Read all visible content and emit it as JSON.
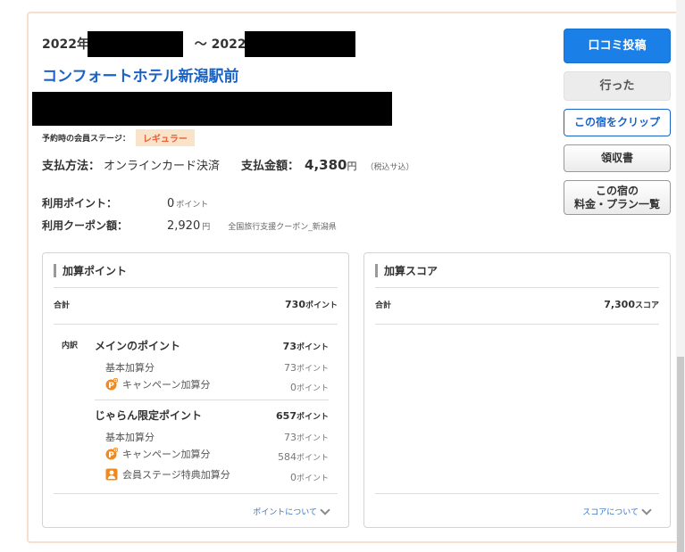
{
  "reservation": {
    "date_start": "2022年",
    "date_sep": "～ 2022年",
    "hotel_name": "コンフォートホテル新潟駅前",
    "member_stage_label": "予約時の会員ステージ：",
    "member_stage": "レギュラー",
    "payment_method_label": "支払方法：",
    "payment_method": "オンラインカード決済",
    "payment_amount_label": "支払金額：",
    "payment_amount": "4,380",
    "payment_unit": "円",
    "tax_note": "（税込サ込）",
    "points_used_label": "利用ポイント：",
    "points_used": "0",
    "points_used_unit": "ポイント",
    "coupon_label": "利用クーポン額：",
    "coupon_amount": "2,920",
    "coupon_unit": "円",
    "coupon_name": "全国旅行支援クーポン_新潟県"
  },
  "actions": {
    "review": "口コミ投稿",
    "visited": "行った",
    "clip": "この宿をクリップ",
    "receipt": "領収書",
    "plan_line1": "この宿の",
    "plan_line2": "料金・プラン一覧"
  },
  "points_panel": {
    "title": "加算ポイント",
    "total_label": "合計",
    "total_value": "730",
    "total_unit": "ポイント",
    "breakdown_label": "内訳",
    "main": {
      "label": "メインのポイント",
      "value": "73",
      "unit": "ポイント",
      "base_label": "基本加算分",
      "base_value": "73",
      "campaign_label": "キャンペーン加算分",
      "campaign_value": "0"
    },
    "jalan": {
      "label": "じゃらん限定ポイント",
      "value": "657",
      "unit": "ポイント",
      "base_label": "基本加算分",
      "base_value": "73",
      "campaign_label": "キャンペーン加算分",
      "campaign_value": "584",
      "stage_label": "会員ステージ特典加算分",
      "stage_value": "0"
    },
    "link": "ポイントについて"
  },
  "score_panel": {
    "title": "加算スコア",
    "total_label": "合計",
    "total_value": "7,300",
    "total_unit": "スコア",
    "link": "スコアについて"
  },
  "colors": {
    "accent": "#1a7fe6",
    "hotel_link": "#1a63c6",
    "point_icon": "#f08a1d",
    "card_border": "#f9ddd1"
  },
  "icons": [
    "point-campaign-icon",
    "member-stage-icon",
    "chevron-down-icon"
  ]
}
